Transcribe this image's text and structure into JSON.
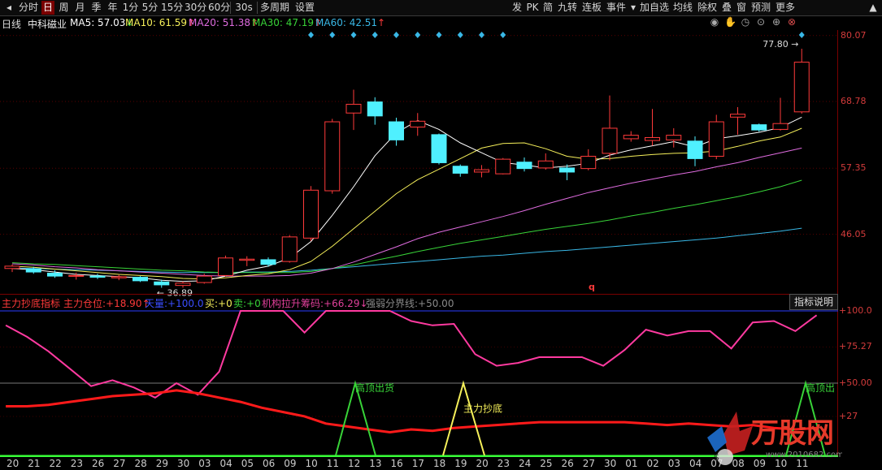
{
  "toolbar": {
    "left": [
      "分时",
      "日",
      "周",
      "月",
      "季",
      "年",
      "1分",
      "5分",
      "15分",
      "30分",
      "60分",
      "30s",
      "多周期",
      "设置"
    ],
    "active": "日",
    "right": [
      "发",
      "PK",
      "简",
      "九转",
      "连板",
      "事件",
      "加自选",
      "均线",
      "除权",
      "叠",
      "窗",
      "预测",
      "更多"
    ],
    "dropdown_glyph": "▾",
    "scroll_glyph": "▲"
  },
  "info": {
    "period": "日线",
    "name": "中科磁业",
    "ma5": "MA5: 57.03",
    "ma5_arrow": "↓",
    "ma10": "MA10: 61.59",
    "ma10_arrow": "↑",
    "ma20": "MA20: 51.38",
    "ma20_arrow": "↑",
    "ma30": "MA30: 47.19",
    "ma30_arrow": "↑",
    "ma60": "MA60: 42.51",
    "ma60_arrow": "↑"
  },
  "price_axis": [
    "80.07",
    "68.78",
    "57.35",
    "46.05"
  ],
  "annotations": {
    "high": "77.80",
    "low": "36.89",
    "marker": "q"
  },
  "indicator": {
    "name": "主力抄底指标",
    "pos_label": "主力仓位:",
    "pos_value": "+18.90",
    "pos_arrow": "↑",
    "sky_label": "天量:",
    "sky_value": "+100.0",
    "buy_label": "买:",
    "buy_value": "+0",
    "sell_label": "卖:",
    "sell_value": "+0",
    "chip_label": "机构拉升筹码:",
    "chip_value": "+66.29",
    "chip_arrow": "↓",
    "line_label": "强弱分界线:",
    "line_value": "+50.00",
    "button": "指标说明",
    "axis": [
      "100.0",
      "75.27",
      "50.00",
      "27"
    ],
    "labels": {
      "top1": "高顶出货",
      "bottom": "主力抄底",
      "top2": "高顶出"
    }
  },
  "x_labels": [
    "20",
    "21",
    "22",
    "23",
    "26",
    "27",
    "28",
    "29",
    "30",
    "03",
    "04",
    "05",
    "06",
    "09",
    "10",
    "11",
    "12",
    "13",
    "16",
    "17",
    "18",
    "19",
    "20",
    "23",
    "24",
    "25",
    "26",
    "27",
    "30",
    "01",
    "02",
    "03",
    "04",
    "07",
    "08",
    "09",
    "10",
    "11"
  ],
  "logo_text": "万股网",
  "logo_sub": "www.2010682.com",
  "colors": {
    "up": "#ff3a3a",
    "down": "#4ff0ff",
    "ma5": "#ffffff",
    "ma10": "#f6f05a",
    "ma20": "#e06ce0",
    "ma30": "#38d338",
    "ma60": "#39b7e5"
  },
  "chart_data": {
    "type": "candlestick",
    "ylim": [
      36.0,
      81.0
    ],
    "candles": [
      {
        "o": 40.2,
        "h": 40.9,
        "l": 39.6,
        "c": 40.6
      },
      {
        "o": 40.1,
        "h": 40.5,
        "l": 39.3,
        "c": 39.6
      },
      {
        "o": 39.4,
        "h": 39.9,
        "l": 38.6,
        "c": 38.9
      },
      {
        "o": 38.9,
        "h": 39.5,
        "l": 38.3,
        "c": 39.0
      },
      {
        "o": 38.9,
        "h": 39.3,
        "l": 38.4,
        "c": 38.7
      },
      {
        "o": 38.6,
        "h": 39.1,
        "l": 38.2,
        "c": 38.8
      },
      {
        "o": 38.7,
        "h": 38.9,
        "l": 37.9,
        "c": 38.1
      },
      {
        "o": 37.9,
        "h": 38.3,
        "l": 36.9,
        "c": 37.4
      },
      {
        "o": 37.3,
        "h": 38.0,
        "l": 36.9,
        "c": 37.7
      },
      {
        "o": 37.8,
        "h": 39.3,
        "l": 37.6,
        "c": 38.9
      },
      {
        "o": 39.0,
        "h": 42.4,
        "l": 38.8,
        "c": 42.0
      },
      {
        "o": 41.6,
        "h": 42.3,
        "l": 40.6,
        "c": 41.8
      },
      {
        "o": 41.7,
        "h": 42.1,
        "l": 40.5,
        "c": 40.9
      },
      {
        "o": 41.4,
        "h": 45.9,
        "l": 41.2,
        "c": 45.6
      },
      {
        "o": 45.4,
        "h": 54.3,
        "l": 44.9,
        "c": 53.6
      },
      {
        "o": 53.5,
        "h": 65.8,
        "l": 53.0,
        "c": 65.3
      },
      {
        "o": 66.8,
        "h": 70.8,
        "l": 63.9,
        "c": 68.3
      },
      {
        "o": 68.7,
        "h": 69.5,
        "l": 64.8,
        "c": 66.3
      },
      {
        "o": 65.3,
        "h": 66.0,
        "l": 61.2,
        "c": 62.2
      },
      {
        "o": 64.4,
        "h": 66.8,
        "l": 62.9,
        "c": 65.4
      },
      {
        "o": 63.1,
        "h": 63.3,
        "l": 58.0,
        "c": 58.3
      },
      {
        "o": 57.7,
        "h": 58.0,
        "l": 55.9,
        "c": 56.5
      },
      {
        "o": 56.7,
        "h": 57.9,
        "l": 55.8,
        "c": 57.1
      },
      {
        "o": 56.4,
        "h": 59.1,
        "l": 56.3,
        "c": 58.9
      },
      {
        "o": 58.4,
        "h": 59.2,
        "l": 56.8,
        "c": 57.3
      },
      {
        "o": 57.4,
        "h": 59.9,
        "l": 57.1,
        "c": 58.6
      },
      {
        "o": 57.4,
        "h": 58.0,
        "l": 55.3,
        "c": 56.7
      },
      {
        "o": 57.3,
        "h": 60.6,
        "l": 57.0,
        "c": 59.4
      },
      {
        "o": 59.9,
        "h": 69.8,
        "l": 58.7,
        "c": 64.2
      },
      {
        "o": 62.4,
        "h": 63.7,
        "l": 61.9,
        "c": 63.0
      },
      {
        "o": 62.1,
        "h": 67.5,
        "l": 61.2,
        "c": 62.6
      },
      {
        "o": 62.2,
        "h": 64.2,
        "l": 60.9,
        "c": 63.0
      },
      {
        "o": 62.0,
        "h": 62.8,
        "l": 57.7,
        "c": 59.0
      },
      {
        "o": 59.4,
        "h": 66.5,
        "l": 58.9,
        "c": 65.3
      },
      {
        "o": 66.1,
        "h": 67.8,
        "l": 63.1,
        "c": 66.6
      },
      {
        "o": 64.8,
        "h": 65.0,
        "l": 63.6,
        "c": 63.9
      },
      {
        "o": 64.0,
        "h": 69.4,
        "l": 63.8,
        "c": 65.0
      },
      {
        "o": 67.0,
        "h": 77.8,
        "l": 66.7,
        "c": 75.5
      }
    ],
    "ma5": [
      40.2,
      40.0,
      39.6,
      39.2,
      39.0,
      38.8,
      38.6,
      38.2,
      38.0,
      38.1,
      38.9,
      39.9,
      40.6,
      42.0,
      44.8,
      49.3,
      54.2,
      59.5,
      63.4,
      65.5,
      64.0,
      61.7,
      60.0,
      58.3,
      57.9,
      57.4,
      57.7,
      58.2,
      59.6,
      60.5,
      61.2,
      61.9,
      61.0,
      62.4,
      62.9,
      63.5,
      64.3,
      66.1
    ],
    "ma10": [
      40.6,
      40.4,
      40.1,
      39.8,
      39.5,
      39.2,
      39.0,
      38.8,
      38.5,
      38.4,
      38.6,
      39.0,
      39.3,
      40.0,
      41.4,
      44.0,
      47.0,
      50.0,
      53.0,
      55.4,
      57.2,
      59.0,
      60.8,
      61.6,
      61.7,
      60.7,
      59.4,
      58.9,
      59.0,
      59.4,
      59.7,
      59.9,
      60.0,
      60.3,
      61.1,
      62.0,
      62.7,
      64.2
    ],
    "ma20": [
      41.0,
      40.8,
      40.5,
      40.3,
      40.0,
      39.8,
      39.6,
      39.4,
      39.2,
      39.0,
      38.9,
      38.9,
      38.9,
      39.0,
      39.4,
      40.2,
      41.3,
      42.6,
      43.9,
      45.3,
      46.4,
      47.3,
      48.2,
      49.1,
      50.1,
      51.2,
      52.2,
      53.2,
      54.0,
      54.8,
      55.5,
      56.2,
      56.8,
      57.6,
      58.3,
      59.2,
      60.0,
      60.8
    ],
    "ma30": [
      41.2,
      41.0,
      40.9,
      40.7,
      40.5,
      40.3,
      40.1,
      39.9,
      39.8,
      39.6,
      39.5,
      39.5,
      39.5,
      39.5,
      39.7,
      40.2,
      40.8,
      41.6,
      42.3,
      43.1,
      43.8,
      44.5,
      45.1,
      45.7,
      46.3,
      46.9,
      47.4,
      47.9,
      48.5,
      49.2,
      49.8,
      50.5,
      51.1,
      51.8,
      52.5,
      53.3,
      54.2,
      55.3
    ],
    "ma60": [
      40.3,
      40.2,
      40.1,
      40.0,
      39.9,
      39.8,
      39.7,
      39.6,
      39.5,
      39.5,
      39.5,
      39.6,
      39.6,
      39.7,
      39.9,
      40.2,
      40.5,
      40.8,
      41.1,
      41.4,
      41.7,
      42.0,
      42.3,
      42.5,
      42.8,
      43.1,
      43.3,
      43.6,
      43.9,
      44.2,
      44.5,
      44.8,
      45.1,
      45.4,
      45.8,
      46.2,
      46.6,
      47.1
    ],
    "diamond_index": [
      14,
      15,
      16,
      17,
      18,
      19,
      20,
      21,
      22,
      23,
      37
    ],
    "indicator_series": {
      "chip": [
        90,
        82,
        72,
        60,
        48,
        52,
        47,
        40,
        50,
        42,
        58,
        100,
        100,
        100,
        85,
        100,
        100,
        100,
        100,
        93,
        90,
        91,
        70,
        62,
        64,
        68,
        68,
        68,
        62,
        73,
        87,
        83,
        86,
        86,
        74,
        92,
        93,
        86,
        97
      ],
      "position": [
        34,
        34,
        35,
        37,
        39,
        41,
        42,
        43,
        45,
        43,
        40,
        37,
        33,
        30,
        27,
        22,
        20,
        18,
        16,
        18,
        17,
        19,
        20,
        21,
        22,
        23,
        23,
        23,
        23,
        23,
        22,
        21,
        22,
        21,
        20,
        21,
        19,
        18,
        19
      ]
    }
  }
}
